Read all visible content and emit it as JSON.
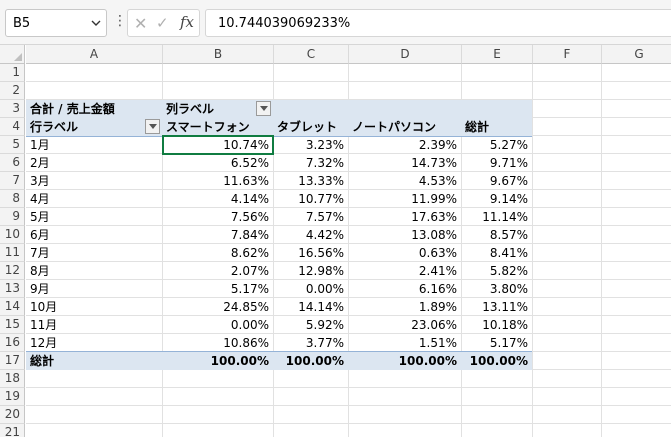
{
  "formula_bar": {
    "name_box": "B5",
    "dots": "⋮",
    "cancel_glyph": "✕",
    "enter_glyph": "✓",
    "fx_label": "fx",
    "formula": "10.744039069233%"
  },
  "columns": [
    "A",
    "B",
    "C",
    "D",
    "E",
    "F",
    "G"
  ],
  "rows": [
    "1",
    "2",
    "3",
    "4",
    "5",
    "6",
    "7",
    "8",
    "9",
    "10",
    "11",
    "12",
    "13",
    "14",
    "15",
    "16",
    "17",
    "18",
    "19",
    "20",
    "21"
  ],
  "pivot": {
    "value_caption": "合計 / 売上金額",
    "col_label_caption": "列ラベル",
    "row_label_caption": "行ラベル",
    "headers": [
      "スマートフォン",
      "タブレット",
      "ノートパソコン",
      "総計"
    ],
    "months": [
      "1月",
      "2月",
      "3月",
      "4月",
      "5月",
      "6月",
      "7月",
      "8月",
      "9月",
      "10月",
      "11月",
      "12月"
    ],
    "values": [
      [
        "10.74%",
        "3.23%",
        "2.39%",
        "5.27%"
      ],
      [
        "6.52%",
        "7.32%",
        "14.73%",
        "9.71%"
      ],
      [
        "11.63%",
        "13.33%",
        "4.53%",
        "9.67%"
      ],
      [
        "4.14%",
        "10.77%",
        "11.99%",
        "9.14%"
      ],
      [
        "7.56%",
        "7.57%",
        "17.63%",
        "11.14%"
      ],
      [
        "7.84%",
        "4.42%",
        "13.08%",
        "8.57%"
      ],
      [
        "8.62%",
        "16.56%",
        "0.63%",
        "8.41%"
      ],
      [
        "2.07%",
        "12.98%",
        "2.41%",
        "5.82%"
      ],
      [
        "5.17%",
        "0.00%",
        "6.16%",
        "3.80%"
      ],
      [
        "24.85%",
        "14.14%",
        "1.89%",
        "13.11%"
      ],
      [
        "0.00%",
        "5.92%",
        "23.06%",
        "10.18%"
      ],
      [
        "10.86%",
        "3.77%",
        "1.51%",
        "5.17%"
      ]
    ],
    "total_label": "総計",
    "totals": [
      "100.00%",
      "100.00%",
      "100.00%",
      "100.00%"
    ]
  },
  "colors": {
    "pivot_band": "#dce6f1",
    "pivot_line": "#95b3d7"
  }
}
